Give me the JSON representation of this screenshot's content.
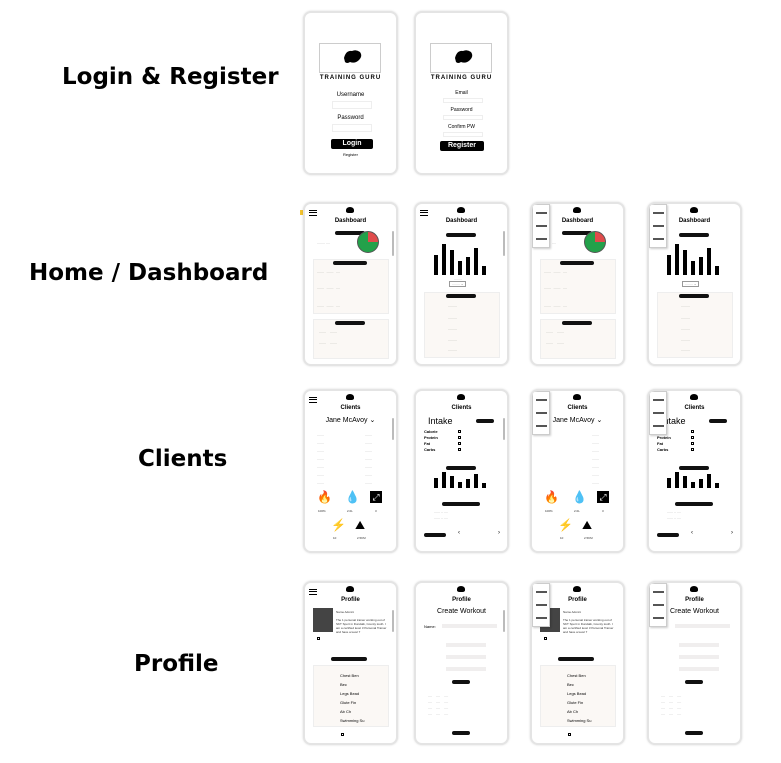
{
  "sections": [
    {
      "label": "Login & Register"
    },
    {
      "label": "Home / Dashboard"
    },
    {
      "label": "Clients"
    },
    {
      "label": "Profile"
    }
  ],
  "login": {
    "brand": "TRAINING GURU",
    "username_label": "Username",
    "password_label": "Password",
    "login_button": "Login",
    "register_link": "Register"
  },
  "register": {
    "brand": "TRAINING GURU",
    "email_label": "Email",
    "password_label": "Password",
    "confirm_label": "Confirm PW",
    "register_button": "Register"
  },
  "dashboard": {
    "title": "Dashboard"
  },
  "clients": {
    "title": "Clients",
    "client_name": "Jane McAvoy",
    "intake_label": "Intake",
    "nutrients": [
      "Calorie",
      "Protein",
      "Fat",
      "Carbs"
    ],
    "icon_values": [
      "100%",
      "2.0L",
      "3",
      "10",
      "2.5KM"
    ]
  },
  "profile": {
    "title": "Profile",
    "create_workout_title": "Create Workout",
    "name_label": "Name:",
    "name_value": "Name Adonni",
    "bio": "The 1 personal trainer working out of SKT Sport in Dundalk, County louth. I am a certified level 3 Personal Trainer and have a level 7",
    "exercises": [
      "Chest Ben",
      "Bec",
      "Legs Bead",
      "Glute Fin",
      "Ab Ch",
      "Swimming Su"
    ],
    "number_of": "Number of"
  }
}
